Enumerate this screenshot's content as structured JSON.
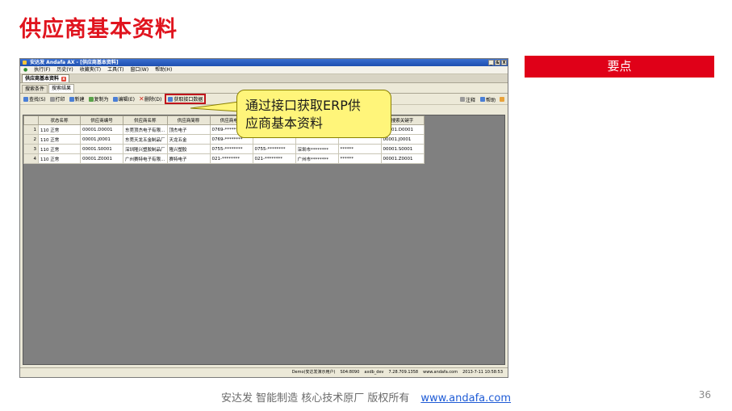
{
  "slide": {
    "title": "供应商基本资料",
    "keypoint": "要点",
    "callout_line1": "通过接口获取ERP供",
    "callout_line2": "应商基本资料",
    "footer_text": "安达发   智能制造 核心技术原厂    版权所有",
    "footer_link": "www.andafa.com",
    "page_number": "36"
  },
  "app": {
    "window_title": "安达发 Andafa AX - [供应商基本资料]",
    "window_controls": [
      "_",
      "&",
      "X"
    ],
    "menu": [
      "执行(F)",
      "历史(Y)",
      "收藏夹(T)",
      "工具(T)",
      "窗口(W)",
      "帮助(H)"
    ],
    "doc_tab": "供应商基本资料",
    "sub_tabs": [
      "搜索条件",
      "搜索结果"
    ],
    "toolbar": {
      "search": "查找(S)",
      "print": "打印",
      "new": "新建",
      "copy": "复制为",
      "edit": "编辑(E)",
      "delete": "删除(D)",
      "fetch": "获取接口数据",
      "note": "注释",
      "help": "帮助"
    },
    "grid": {
      "columns": [
        "状态名称",
        "供应商编号",
        "供应商名称",
        "供应商简称",
        "供应商电话",
        "",
        "",
        "",
        "搜索关键字"
      ],
      "rows": [
        [
          "1",
          "110 正常",
          "00001.D0001",
          "东莞顶杰电子有限...",
          "顶杰电子",
          "0769-********",
          "",
          "",
          "",
          "00001.D0001"
        ],
        [
          "2",
          "110 正常",
          "00001.J0001",
          "东莞天龙五金制品厂",
          "天龙五金",
          "0769-********",
          "",
          "",
          "",
          "00001.J0001"
        ],
        [
          "3",
          "110 正常",
          "00001.S0001",
          "深圳隆兴塑胶制品厂",
          "隆兴塑胶",
          "0755-********",
          "0755-********",
          "深圳市********",
          "******",
          "00001.S0001"
        ],
        [
          "4",
          "110 正常",
          "00001.Z0001",
          "广州赛特电子有限...",
          "赛特电子",
          "021-********",
          "021-********",
          "广州市********",
          "******",
          "00001.Z0001"
        ]
      ]
    },
    "status": {
      "user": "Demo(安达发演示用户)",
      "server": "S04:8090",
      "db": "axdb_dev",
      "version": "7.28.709.1358",
      "site": "www.andafa.com",
      "datetime": "2013-7-11 10:58:53"
    }
  }
}
